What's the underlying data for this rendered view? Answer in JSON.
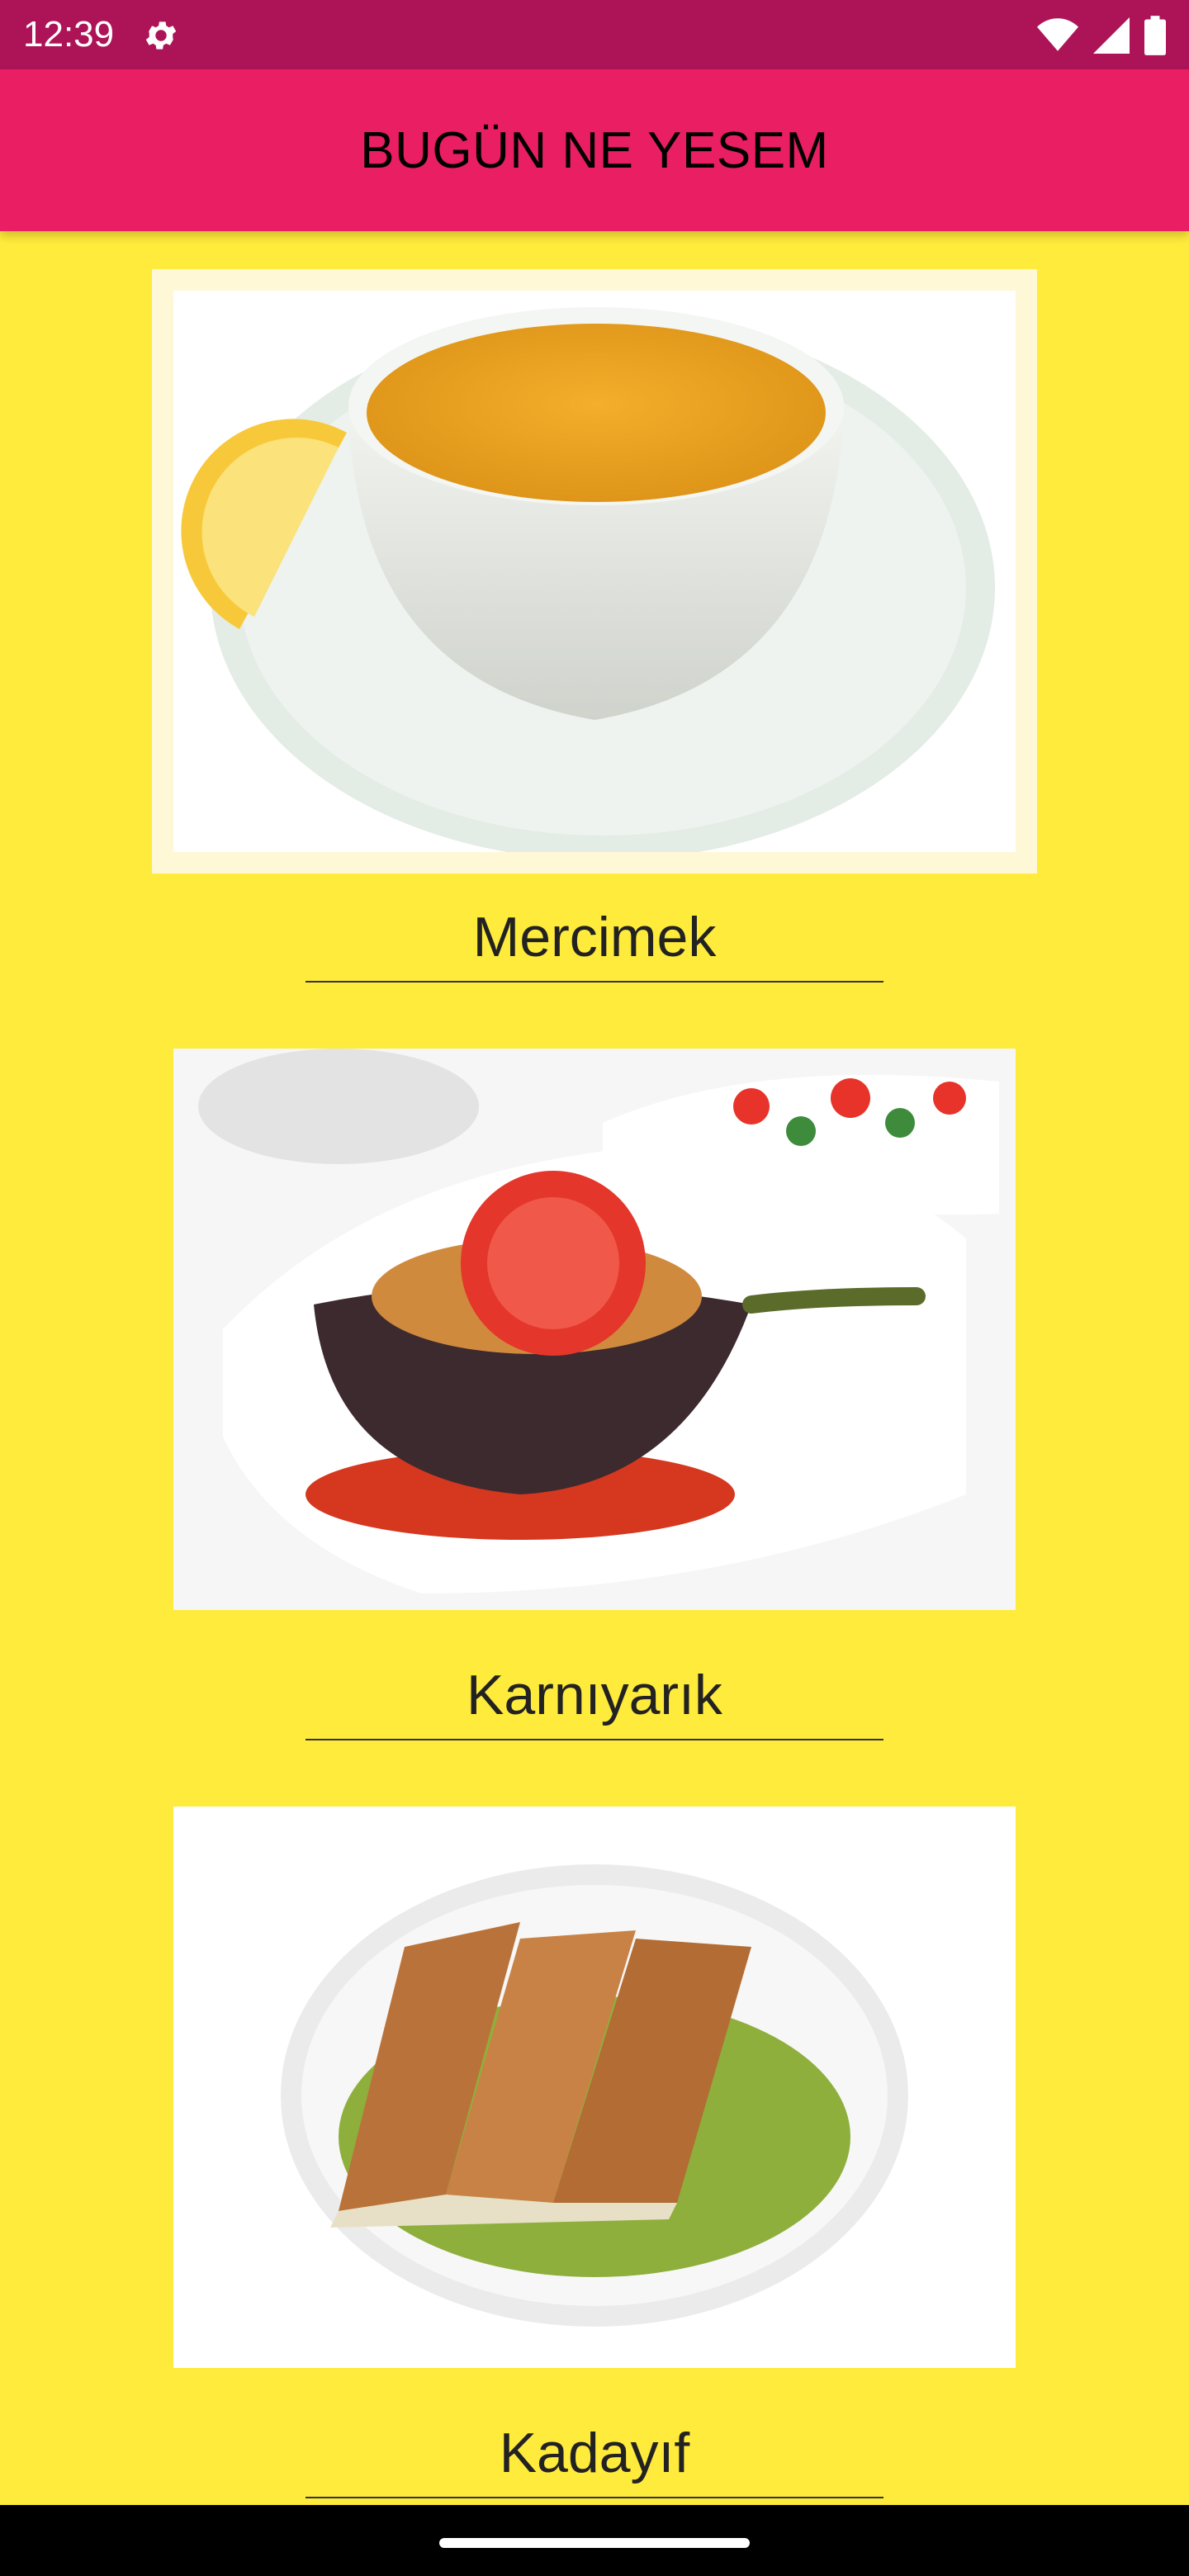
{
  "status_bar": {
    "time": "12:39",
    "icons": [
      "settings-icon",
      "wifi-icon",
      "cellular-signal-icon",
      "battery-icon"
    ]
  },
  "app_bar": {
    "title": "BUGÜN NE YESEM"
  },
  "dishes": [
    {
      "name": "Mercimek",
      "image": "lentil-soup-image",
      "selected": true
    },
    {
      "name": "Karnıyarık",
      "image": "stuffed-eggplant-image",
      "selected": false
    },
    {
      "name": "Kadayıf",
      "image": "kadayif-dessert-image",
      "selected": false
    }
  ],
  "colors": {
    "status_bar": "#AD1457",
    "app_bar": "#E91E63",
    "background": "#FFEB3B",
    "selected_highlight": "#FFF8D6"
  }
}
